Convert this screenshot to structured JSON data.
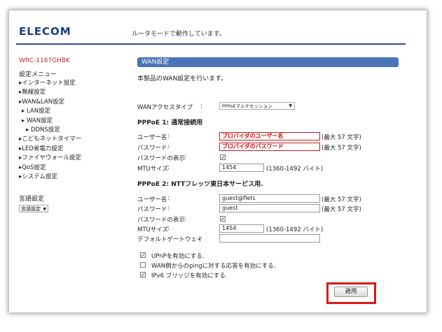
{
  "header": {
    "logo": "ELECOM",
    "status": "ルータモードで動作しています。"
  },
  "sidebar": {
    "model": "WRC-1167GHBK",
    "menu_title": "設定メニュー",
    "items": [
      {
        "label": "▸インターネット設定",
        "level": 1
      },
      {
        "label": "▸無線設定",
        "level": 1
      },
      {
        "label": "▸WAN&LAN設定",
        "level": 1
      },
      {
        "label": "▸ LAN設定",
        "level": 2
      },
      {
        "label": "▸ WAN設定",
        "level": 2
      },
      {
        "label": "▸ DDNS設定",
        "level": 3
      },
      {
        "label": "▸こどもネットタイマー",
        "level": 1
      },
      {
        "label": "▸LED省電力設定",
        "level": 1
      },
      {
        "label": "▸ファイヤウォール設定",
        "level": 1
      },
      {
        "label": "▸QoS設定",
        "level": 1
      },
      {
        "label": "▸システム設定",
        "level": 1
      }
    ],
    "lang_title": "言語設定",
    "lang_select": "言語設定"
  },
  "main": {
    "section_title": "WAN設定",
    "description": "本製品のWAN設定を行います。",
    "wan_access": {
      "label": "WANアクセスタイプ",
      "colon": ":",
      "value": "PPPoEマルチセッション"
    },
    "pppoe1": {
      "heading": "PPPoE 1: 通常接続用",
      "user_label": "ユーザー名",
      "user_value": "プロバイダのユーザー名",
      "user_note": "(最大 57 文字)",
      "pass_label": "パスワード",
      "pass_value": "プロバイダのパスワード",
      "pass_note": "(最大 57 文字)",
      "show_label": "パスワードの表示",
      "show_checked": true,
      "mtu_label": "MTUサイズ",
      "mtu_value": "1454",
      "mtu_note": "(1360-1492 バイト)"
    },
    "pppoe2": {
      "heading": "PPPoE 2: NTTフレッツ東日本サービス用.",
      "user_label": "ユーザー名",
      "user_value": "guest@flets",
      "user_note": "(最大 57 文字)",
      "pass_label": "パスワード",
      "pass_value": "guest",
      "pass_note": "(最大 57 文字)",
      "show_label": "パスワードの表示",
      "show_checked": true,
      "mtu_label": "MTUサイズ",
      "mtu_value": "1454",
      "mtu_note": "(1360-1492 バイト)",
      "gw_label": "デフォルトゲートウェイ",
      "gw_value": ""
    },
    "options": [
      {
        "label": "UPnPを有効にする.",
        "checked": true
      },
      {
        "label": "WAN側からのpingに対する応答を有効にする.",
        "checked": false
      },
      {
        "label": "IPv6 ブリッジを有効にする.",
        "checked": true
      }
    ],
    "apply_label": "適用",
    "colon": ":",
    "check_mark": "✓"
  }
}
